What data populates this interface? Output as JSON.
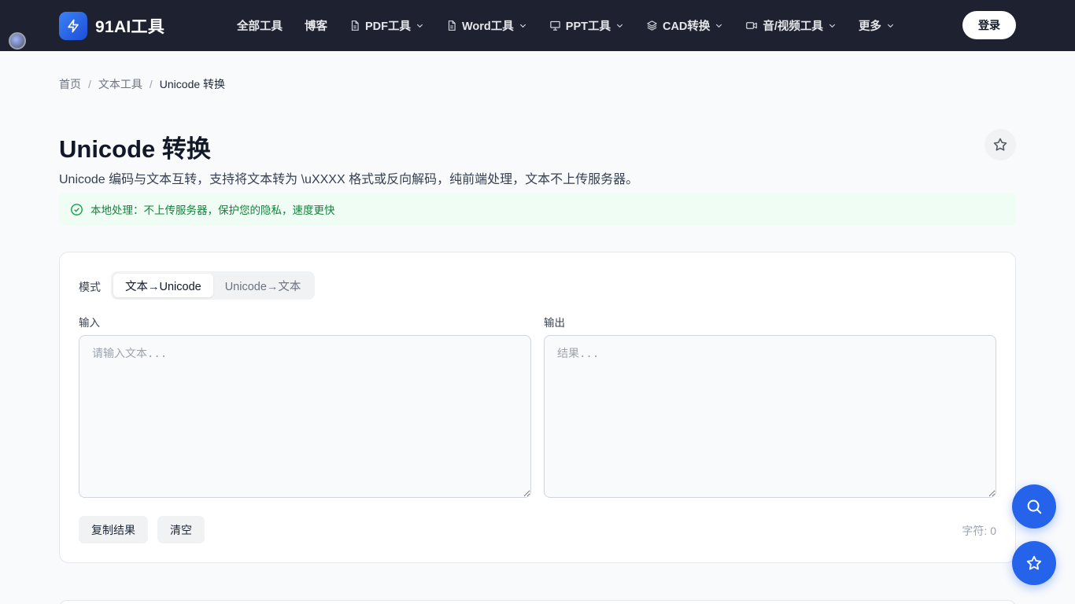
{
  "header": {
    "brand": "91AI工具",
    "logo_icon": "lightning-icon",
    "nav": [
      {
        "label": "全部工具",
        "icon": "",
        "dropdown": false
      },
      {
        "label": "博客",
        "icon": "",
        "dropdown": false
      },
      {
        "label": "PDF工具",
        "icon": "document-icon",
        "dropdown": true
      },
      {
        "label": "Word工具",
        "icon": "document-icon",
        "dropdown": true
      },
      {
        "label": "PPT工具",
        "icon": "presentation-icon",
        "dropdown": true
      },
      {
        "label": "CAD转换",
        "icon": "layers-icon",
        "dropdown": true
      },
      {
        "label": "音/视频工具",
        "icon": "video-icon",
        "dropdown": true
      },
      {
        "label": "更多",
        "icon": "",
        "dropdown": true
      }
    ],
    "login_label": "登录"
  },
  "breadcrumb": {
    "home": "首页",
    "category": "文本工具",
    "current": "Unicode 转换",
    "separator": "/"
  },
  "page": {
    "title": "Unicode 转换",
    "subtitle": "Unicode 编码与文本互转，支持将文本转为 \\uXXXX 格式或反向解码，纯前端处理，文本不上传服务器。",
    "notice": "本地处理：不上传服务器，保护您的隐私，速度更快"
  },
  "tool": {
    "mode_label": "模式",
    "modes": [
      "文本→Unicode",
      "Unicode→文本"
    ],
    "active_mode": "文本→Unicode",
    "input_label": "输入",
    "input_value": "",
    "input_placeholder": "请输入文本...",
    "output_label": "输出",
    "output_value": "",
    "output_placeholder": "结果...",
    "copy_label": "复制结果",
    "clear_label": "清空",
    "char_count": "字符: 0"
  },
  "colors": {
    "header_bg": "#1e2230",
    "accent": "#2563eb",
    "notice_bg": "#f0fdf4",
    "notice_text": "#15803d"
  }
}
